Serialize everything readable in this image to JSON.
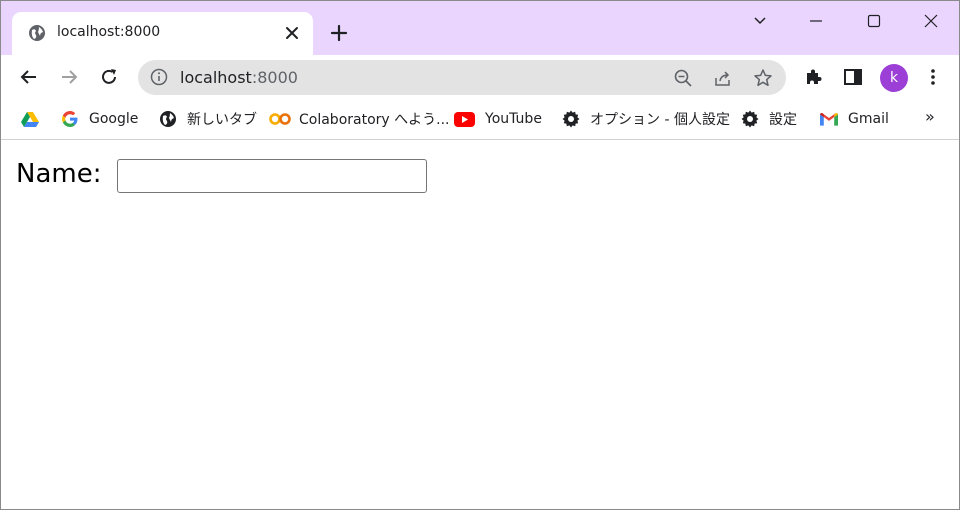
{
  "browser": {
    "tab": {
      "title": "localhost:8000",
      "favicon": "globe-icon"
    },
    "new_tab_icon": "plus-icon",
    "window_controls": [
      "chevron-down-icon",
      "minimize-icon",
      "maximize-icon",
      "close-icon"
    ],
    "accent_color": "#e9d5fe"
  },
  "toolbar": {
    "url_host": "localhost",
    "url_port": ":8000",
    "avatar_letter": "k",
    "avatar_color": "#9b3fd6"
  },
  "bookmarks": {
    "items": [
      {
        "label": "",
        "icon": "google-drive-icon"
      },
      {
        "label": "Google",
        "icon": "google-icon"
      },
      {
        "label": "新しいタブ",
        "icon": "globe-icon"
      },
      {
        "label": "Colaboratory へよう...",
        "icon": "colab-icon"
      },
      {
        "label": "YouTube",
        "icon": "youtube-icon"
      },
      {
        "label": "オプション - 個人設定",
        "icon": "gear-icon"
      },
      {
        "label": "設定",
        "icon": "gear-icon"
      },
      {
        "label": "Gmail",
        "icon": "gmail-icon"
      }
    ],
    "more": "»"
  },
  "page": {
    "name_label": "Name:",
    "name_value": "",
    "name_placeholder": ""
  }
}
